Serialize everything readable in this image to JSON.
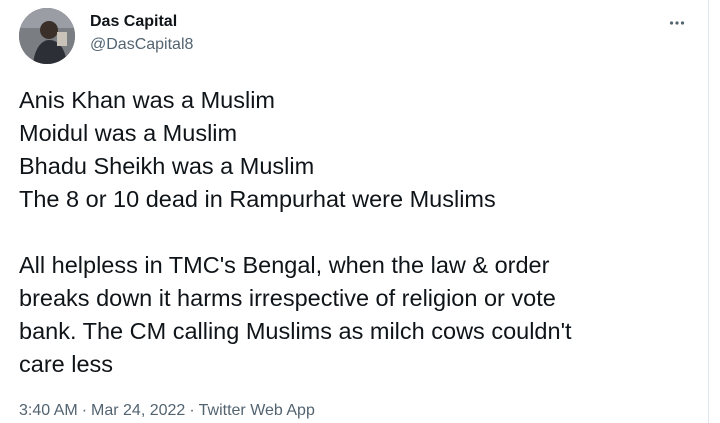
{
  "author": {
    "name": "Das Capital",
    "handle": "@DasCapital8"
  },
  "icons": {
    "avatar": "profile-photo",
    "more": "more-horizontal-icon"
  },
  "tweet": {
    "lines": [
      "Anis Khan was a Muslim",
      "Moidul was a Muslim",
      "Bhadu Sheikh was a Muslim",
      "The 8 or 10 dead in Rampurhat were Muslims"
    ],
    "paragraph2_lines": [
      "All helpless in TMC's Bengal, when the law & order",
      "breaks down it harms irrespective of religion or vote",
      "bank. The CM calling Muslims as milch cows couldn't",
      "care less"
    ]
  },
  "meta": {
    "time": "3:40 AM",
    "separator": "·",
    "date": "Mar 24, 2022",
    "source": "Twitter Web App"
  },
  "colors": {
    "text": "#0f1419",
    "secondary": "#536471",
    "border": "#e1e8ed"
  }
}
